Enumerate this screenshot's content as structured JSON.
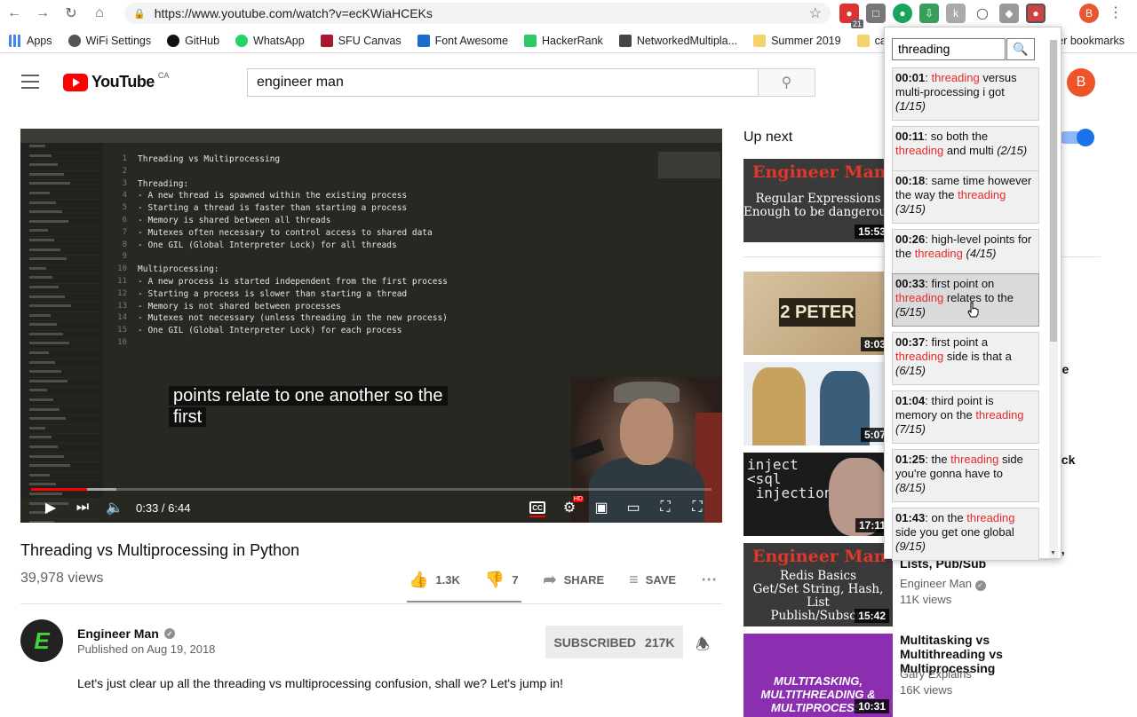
{
  "browser": {
    "url": "https://www.youtube.com/watch?v=ecKWiaHCEKs",
    "ext_badge": "21",
    "profile_initial": "B",
    "bookmarks": [
      "Apps",
      "WiFi Settings",
      "GitHub",
      "WhatsApp",
      "SFU Canvas",
      "Font Awesome",
      "HackerRank",
      "NetworkedMultipla...",
      "Summer 2019",
      "car"
    ],
    "bookmarks_more": "er bookmarks"
  },
  "youtube": {
    "logo_text": "YouTube",
    "logo_region": "CA",
    "search_value": "engineer man",
    "avatar_initial": "B"
  },
  "player": {
    "code_lines": [
      "Threading vs Multiprocessing",
      "",
      "Threading:",
      "- A new thread is spawned within the existing process",
      "- Starting a thread is faster than starting a process",
      "- Memory is shared between all threads",
      "- Mutexes often necessary to control access to shared data",
      "- One GIL (Global Interpreter Lock) for all threads",
      "",
      "Multiprocessing:",
      "- A new process is started independent from the first process",
      "- Starting a process is slower than starting a thread",
      "- Memory is not shared between processes",
      "- Mutexes not necessary (unless threading in the new process)",
      "- One GIL (Global Interpreter Lock) for each process",
      ""
    ],
    "caption_line1": "points relate to one another so the",
    "caption_line2": "first",
    "time": "0:33 / 6:44",
    "played_fraction": 0.082,
    "loaded_fraction": 0.125,
    "cc_label": "CC",
    "hd_label": "HD"
  },
  "video": {
    "title": "Threading vs Multiprocessing in Python",
    "views": "39,978 views",
    "likes": "1.3K",
    "dislikes": "7",
    "share_label": "SHARE",
    "save_label": "SAVE",
    "channel_name": "Engineer Man",
    "channel_initial": "E",
    "published": "Published on Aug 19, 2018",
    "subscribed_label": "SUBSCRIBED",
    "subscriber_count": "217K",
    "description": "Let's just clear up all the threading vs multiprocessing confusion, shall we? Let's jump in!"
  },
  "sidebar": {
    "up_next": "Up next",
    "cards": [
      {
        "duration": "15:53",
        "thumb_title": "Engineer Man",
        "thumb_sub": "Regular Expressions\nEnough to be dangerous"
      },
      {
        "duration": "8:03",
        "thumb_sign": "2 PETER"
      },
      {
        "duration": "5:07"
      },
      {
        "duration": "17:11",
        "thumb_text": "inject\n<sql\n injection"
      },
      {
        "duration": "15:42",
        "thumb_title": "Engineer Man",
        "thumb_sub": "Redis Basics\nGet/Set String, Hash, List\nPublish/Subscri",
        "title_tail": "Lists, Pub/Sub",
        "channel": "Engineer Man",
        "views": "11K views"
      },
      {
        "duration": "10:31",
        "thumb_text": "MULTITASKING,\nMULTITHREADING &\nMULTIPROCESSI",
        "title": "Multitasking vs Multithreading vs Multiprocessing",
        "channel": "Gary Explains",
        "views": "16K views"
      }
    ],
    "partial_texts": [
      "h",
      "ne",
      "ack",
      "s,"
    ]
  },
  "extension": {
    "query": "threading",
    "results": [
      {
        "ts": "00:01",
        "before": ": ",
        "hl": "threading",
        "after": " versus multi-processing i got ",
        "idx": "(1/15)"
      },
      {
        "ts": "00:11",
        "before": ": so both the ",
        "hl": "threading",
        "after": " and multi ",
        "idx": "(2/15)"
      },
      {
        "ts": "00:18",
        "before": ": same time however the way the ",
        "hl": "threading",
        "after": " ",
        "idx": "(3/15)"
      },
      {
        "ts": "00:26",
        "before": ": high-level points for the ",
        "hl": "threading",
        "after": " ",
        "idx": "(4/15)"
      },
      {
        "ts": "00:33",
        "before": ": first point on ",
        "hl": "threading",
        "after": " relates to the ",
        "idx": "(5/15)"
      },
      {
        "ts": "00:37",
        "before": ": first point a ",
        "hl": "threading",
        "after": " side is that a ",
        "idx": "(6/15)"
      },
      {
        "ts": "01:04",
        "before": ": third point is memory on the ",
        "hl": "threading",
        "after": " ",
        "idx": "(7/15)"
      },
      {
        "ts": "01:25",
        "before": ": the ",
        "hl": "threading",
        "after": " side you're gonna have to ",
        "idx": "(8/15)"
      },
      {
        "ts": "01:43",
        "before": ": on the ",
        "hl": "threading",
        "after": " side you get one global ",
        "idx": "(9/15)"
      }
    ],
    "hovered_index": 4
  }
}
